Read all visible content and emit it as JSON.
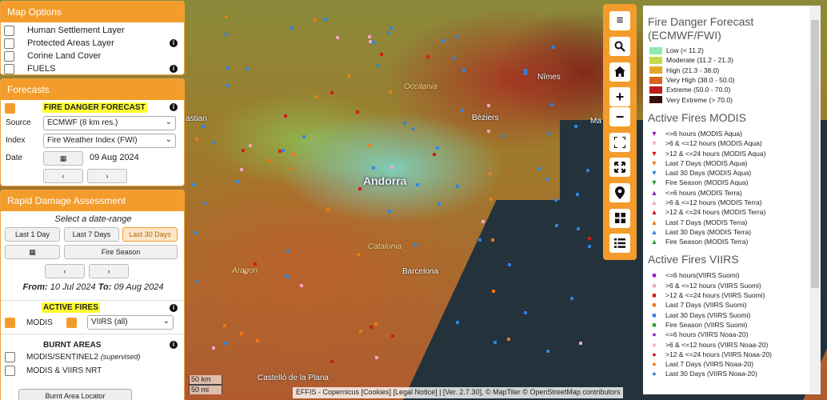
{
  "map_options": {
    "title": "Map Options",
    "layers": [
      {
        "label": "Human Settlement Layer",
        "info": false
      },
      {
        "label": "Protected Areas Layer",
        "info": true
      },
      {
        "label": "Corine Land Cover",
        "info": false
      },
      {
        "label": "FUELS",
        "info": true
      }
    ]
  },
  "forecasts": {
    "title": "Forecasts",
    "fdf_label": "FIRE DANGER FORECAST",
    "source_label": "Source",
    "source_value": "ECMWF (8 km res.)",
    "index_label": "Index",
    "index_value": "Fire Weather Index (FWI)",
    "date_label": "Date",
    "date_value": "09 Aug 2024",
    "prev": "‹",
    "next": "›"
  },
  "rda": {
    "title": "Rapid Damage Assessment",
    "select_range": "Select a date-range",
    "btn_last1": "Last 1 Day",
    "btn_last7": "Last 7 Days",
    "btn_last30": "Last 30 Days",
    "btn_season": "Fire Season",
    "from_label": "From:",
    "from_value": "10 Jul 2024",
    "to_label": "To:",
    "to_value": "09 Aug 2024",
    "active_fires": "ACTIVE FIRES",
    "modis": "MODIS",
    "viirs_select": "VIIRS (all)",
    "burnt_areas": "BURNT AREAS",
    "burnt_1": "MODIS/SENTINEL2",
    "burnt_1_note": "(supervised)",
    "burnt_2": "MODIS & VIIRS NRT",
    "locator": "Burnt Area Locator"
  },
  "map": {
    "labels": {
      "occitania": "Occitania",
      "catalonia": "Catalonia",
      "aragon": "Aragon",
      "andorra": "Andorra",
      "nimes": "Nîmes",
      "beziers": "Béziers",
      "barcelona": "Barcelona",
      "castellon": "Castelló de la Plana",
      "bastian": "astian",
      "ma": "Ma"
    },
    "scale_km": "50 km",
    "scale_mi": "50 mi",
    "attribution": "EFFIS - Copernicus [Cookies] [Legal Notice] | [Ver. 2.7.30], © MapTiler © OpenStreetMap contributors"
  },
  "legend": {
    "fdf_title": "Fire Danger Forecast (ECMWF/FWI)",
    "fdf_classes": [
      {
        "label": "Low (< 11.2)",
        "color": "#8fe8b0"
      },
      {
        "label": "Moderate (11.2 - 21.3)",
        "color": "#c7d94a"
      },
      {
        "label": "High (21.3 - 38.0)",
        "color": "#e0a92a"
      },
      {
        "label": "Very High (38.0 - 50.0)",
        "color": "#d9651f"
      },
      {
        "label": "Extreme (50.0 - 70.0)",
        "color": "#b81e1e"
      },
      {
        "label": "Very Extreme (> 70.0)",
        "color": "#3a0d0d"
      }
    ],
    "modis_title": "Active Fires MODIS",
    "modis_items": [
      {
        "label": "<=6 hours (MODIS Aqua)",
        "symbol": "▼",
        "color": "#9b1ec8"
      },
      {
        "label": ">6 & <=12 hours (MODIS Aqua)",
        "symbol": "▼",
        "color": "#f4a7c3"
      },
      {
        "label": ">12 & <=24 hours (MODIS Aqua)",
        "symbol": "▼",
        "color": "#d21a1a"
      },
      {
        "label": "Last 7 Days (MODIS Aqua)",
        "symbol": "▼",
        "color": "#f07a16"
      },
      {
        "label": "Last 30 Days (MODIS Aqua)",
        "symbol": "▼",
        "color": "#2f86e0"
      },
      {
        "label": "Fire Season (MODIS Aqua)",
        "symbol": "▼",
        "color": "#22a22a"
      },
      {
        "label": "<=6 hours (MODIS Terra)",
        "symbol": "▲",
        "color": "#9b1ec8"
      },
      {
        "label": ">6 & <=12 hours (MODIS Terra)",
        "symbol": "▲",
        "color": "#f4a7c3"
      },
      {
        "label": ">12 & <=24 hours (MODIS Terra)",
        "symbol": "▲",
        "color": "#d21a1a"
      },
      {
        "label": "Last 7 Days (MODIS Terra)",
        "symbol": "▲",
        "color": "#f07a16"
      },
      {
        "label": "Last 30 Days (MODIS Terra)",
        "symbol": "▲",
        "color": "#2f86e0"
      },
      {
        "label": "Fire Season (MODIS Terra)",
        "symbol": "▲",
        "color": "#22a22a"
      }
    ],
    "viirs_title": "Active Fires VIIRS",
    "viirs_items": [
      {
        "label": "<=6 hours(VIIRS Suomi)",
        "symbol": "■",
        "color": "#9b1ec8"
      },
      {
        "label": ">6 & <=12 hours (VIIRS Suomi)",
        "symbol": "■",
        "color": "#f4a7c3"
      },
      {
        "label": ">12 & <=24 hours (VIIRS Suomi)",
        "symbol": "■",
        "color": "#d21a1a"
      },
      {
        "label": "Last 7 Days (VIIRS Suomi)",
        "symbol": "■",
        "color": "#f07a16"
      },
      {
        "label": "Last 30 Days (VIIRS Suomi)",
        "symbol": "■",
        "color": "#2f86e0"
      },
      {
        "label": "Fire Season (VIIRS Suomi)",
        "symbol": "■",
        "color": "#22a22a"
      },
      {
        "label": "<=6 hours (VIIRS Noaa-20)",
        "symbol": "●",
        "color": "#9b1ec8"
      },
      {
        "label": ">6 & <=12 hours (VIIRS Noaa-20)",
        "symbol": "●",
        "color": "#f4a7c3"
      },
      {
        "label": ">12 & <=24 hours (VIIRS Noaa-20)",
        "symbol": "●",
        "color": "#d21a1a"
      },
      {
        "label": "Last 7 Days (VIIRS Noaa-20)",
        "symbol": "●",
        "color": "#f07a16"
      },
      {
        "label": "Last 30 Days (VIIRS Noaa-20)",
        "symbol": "●",
        "color": "#2f86e0"
      }
    ]
  },
  "toolbar": {
    "icons": [
      "menu-icon",
      "search-icon",
      "home-icon",
      "zoom-in-icon",
      "zoom-out-icon",
      "fullscreen-icon",
      "extent-icon",
      "location-pin-icon",
      "grid-icon",
      "list-icon"
    ]
  }
}
